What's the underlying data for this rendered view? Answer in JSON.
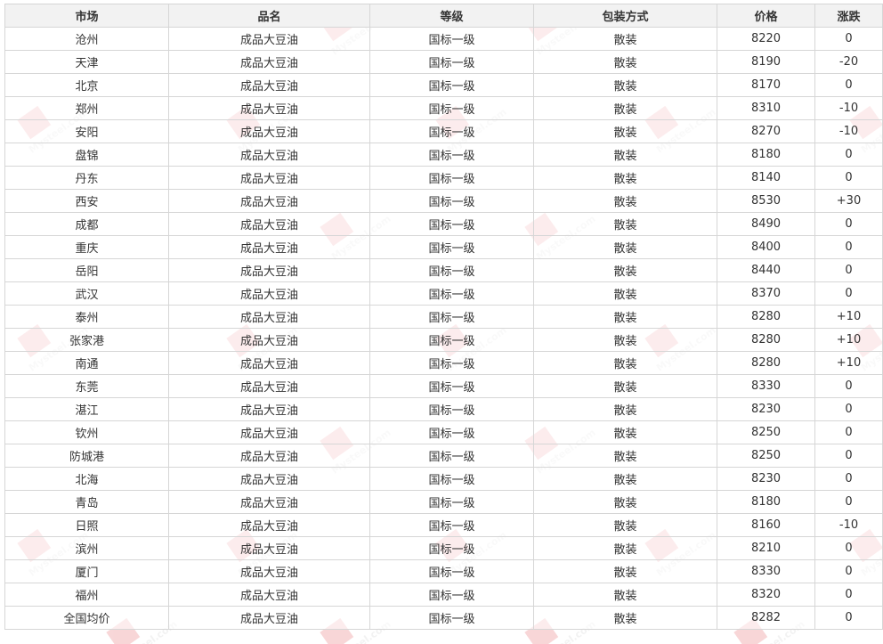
{
  "table": {
    "headers": [
      "市场",
      "品名",
      "等级",
      "包装方式",
      "价格",
      "涨跌"
    ],
    "rows": [
      [
        "沧州",
        "成品大豆油",
        "国标一级",
        "散装",
        "8220",
        "0"
      ],
      [
        "天津",
        "成品大豆油",
        "国标一级",
        "散装",
        "8190",
        "-20"
      ],
      [
        "北京",
        "成品大豆油",
        "国标一级",
        "散装",
        "8170",
        "0"
      ],
      [
        "郑州",
        "成品大豆油",
        "国标一级",
        "散装",
        "8310",
        "-10"
      ],
      [
        "安阳",
        "成品大豆油",
        "国标一级",
        "散装",
        "8270",
        "-10"
      ],
      [
        "盘锦",
        "成品大豆油",
        "国标一级",
        "散装",
        "8180",
        "0"
      ],
      [
        "丹东",
        "成品大豆油",
        "国标一级",
        "散装",
        "8140",
        "0"
      ],
      [
        "西安",
        "成品大豆油",
        "国标一级",
        "散装",
        "8530",
        "+30"
      ],
      [
        "成都",
        "成品大豆油",
        "国标一级",
        "散装",
        "8490",
        "0"
      ],
      [
        "重庆",
        "成品大豆油",
        "国标一级",
        "散装",
        "8400",
        "0"
      ],
      [
        "岳阳",
        "成品大豆油",
        "国标一级",
        "散装",
        "8440",
        "0"
      ],
      [
        "武汉",
        "成品大豆油",
        "国标一级",
        "散装",
        "8370",
        "0"
      ],
      [
        "泰州",
        "成品大豆油",
        "国标一级",
        "散装",
        "8280",
        "+10"
      ],
      [
        "张家港",
        "成品大豆油",
        "国标一级",
        "散装",
        "8280",
        "+10"
      ],
      [
        "南通",
        "成品大豆油",
        "国标一级",
        "散装",
        "8280",
        "+10"
      ],
      [
        "东莞",
        "成品大豆油",
        "国标一级",
        "散装",
        "8330",
        "0"
      ],
      [
        "湛江",
        "成品大豆油",
        "国标一级",
        "散装",
        "8230",
        "0"
      ],
      [
        "钦州",
        "成品大豆油",
        "国标一级",
        "散装",
        "8250",
        "0"
      ],
      [
        "防城港",
        "成品大豆油",
        "国标一级",
        "散装",
        "8250",
        "0"
      ],
      [
        "北海",
        "成品大豆油",
        "国标一级",
        "散装",
        "8230",
        "0"
      ],
      [
        "青岛",
        "成品大豆油",
        "国标一级",
        "散装",
        "8180",
        "0"
      ],
      [
        "日照",
        "成品大豆油",
        "国标一级",
        "散装",
        "8160",
        "-10"
      ],
      [
        "滨州",
        "成品大豆油",
        "国标一级",
        "散装",
        "8210",
        "0"
      ],
      [
        "厦门",
        "成品大豆油",
        "国标一级",
        "散装",
        "8330",
        "0"
      ],
      [
        "福州",
        "成品大豆油",
        "国标一级",
        "散装",
        "8320",
        "0"
      ],
      [
        "全国均价",
        "成品大豆油",
        "国标一级",
        "散装",
        "8282",
        "0"
      ]
    ]
  },
  "watermark": {
    "text": "Mysteel.com",
    "box_color": "#e0474c",
    "text_color": "#c9c9c9"
  }
}
